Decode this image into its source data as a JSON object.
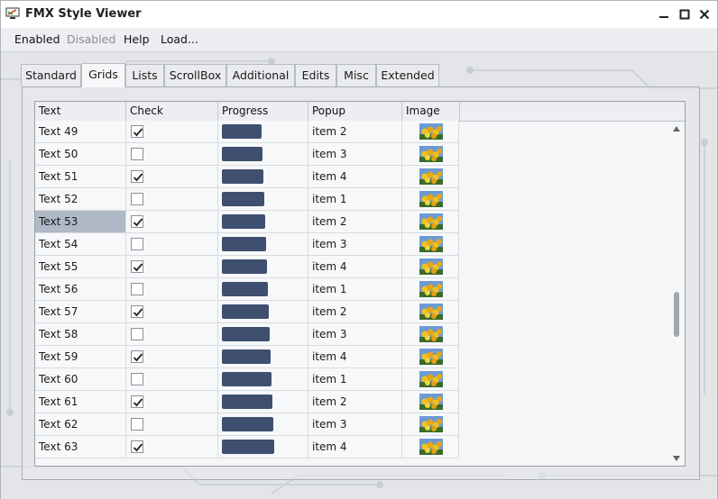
{
  "window": {
    "title": "FMX Style Viewer"
  },
  "menu": [
    "Enabled",
    "Disabled",
    "Help",
    "Load..."
  ],
  "tabs": [
    "Standard",
    "Grids",
    "Lists",
    "ScrollBox",
    "Additional",
    "Edits",
    "Misc",
    "Extended"
  ],
  "active_tab": "Grids",
  "grid": {
    "columns": [
      "Text",
      "Check",
      "Progress",
      "Popup",
      "Image"
    ],
    "selected_row": "Text 53",
    "rows": [
      {
        "text": "Text 49",
        "check": true,
        "progress": 0.42,
        "popup": "item 2"
      },
      {
        "text": "Text 50",
        "check": false,
        "progress": 0.43,
        "popup": "item 3"
      },
      {
        "text": "Text 51",
        "check": true,
        "progress": 0.44,
        "popup": "item 4"
      },
      {
        "text": "Text 52",
        "check": false,
        "progress": 0.45,
        "popup": "item 1"
      },
      {
        "text": "Text 53",
        "check": true,
        "progress": 0.46,
        "popup": "item 2"
      },
      {
        "text": "Text 54",
        "check": false,
        "progress": 0.47,
        "popup": "item 3"
      },
      {
        "text": "Text 55",
        "check": true,
        "progress": 0.48,
        "popup": "item 4"
      },
      {
        "text": "Text 56",
        "check": false,
        "progress": 0.49,
        "popup": "item 1"
      },
      {
        "text": "Text 57",
        "check": true,
        "progress": 0.5,
        "popup": "item 2"
      },
      {
        "text": "Text 58",
        "check": false,
        "progress": 0.51,
        "popup": "item 3"
      },
      {
        "text": "Text 59",
        "check": true,
        "progress": 0.52,
        "popup": "item 4"
      },
      {
        "text": "Text 60",
        "check": false,
        "progress": 0.53,
        "popup": "item 1"
      },
      {
        "text": "Text 61",
        "check": true,
        "progress": 0.54,
        "popup": "item 2"
      },
      {
        "text": "Text 62",
        "check": false,
        "progress": 0.55,
        "popup": "item 3"
      },
      {
        "text": "Text 63",
        "check": true,
        "progress": 0.56,
        "popup": "item 4"
      }
    ]
  },
  "colors": {
    "progress": "#3f4f70",
    "selection": "#aeb8c6"
  },
  "icons": [
    "app-icon",
    "minimize-icon",
    "maximize-icon",
    "close-icon",
    "checkmark-icon",
    "flower-image-icon",
    "scroll-up-icon",
    "scroll-down-icon"
  ]
}
